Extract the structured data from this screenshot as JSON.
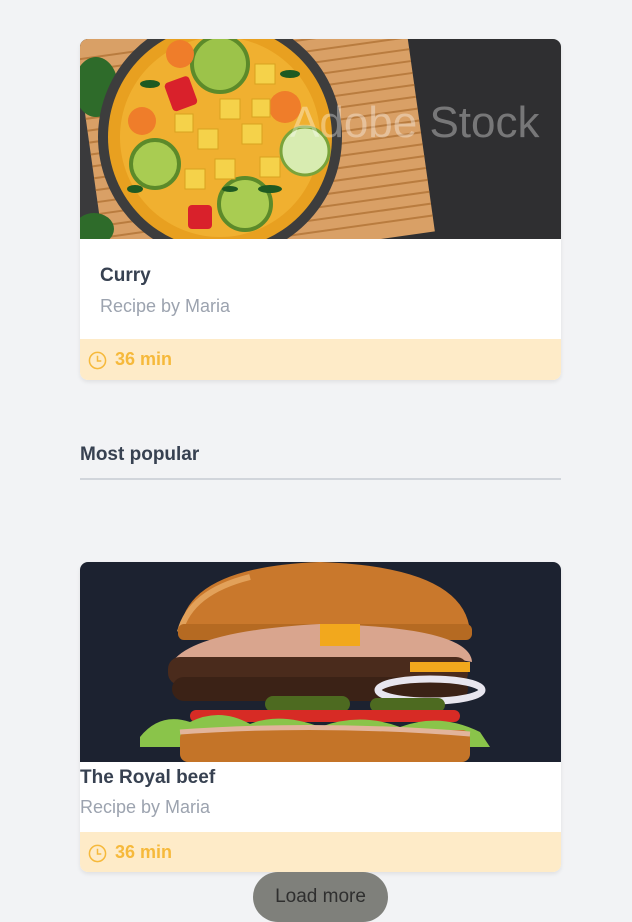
{
  "featured": {
    "title": "Curry",
    "author": "Recipe by Maria",
    "time": "36 min",
    "watermark": "Adobe Stock"
  },
  "section": {
    "heading": "Most popular"
  },
  "popular": {
    "title": "The Royal beef",
    "author": "Recipe by Maria",
    "time": "36 min"
  },
  "actions": {
    "load_more": "Load more"
  },
  "colors": {
    "background": "#f2f3f5",
    "footer_bg": "#feebc8",
    "accent": "#f6b93b",
    "muted_text": "#9ca3af",
    "button_bg": "#7f807b"
  }
}
